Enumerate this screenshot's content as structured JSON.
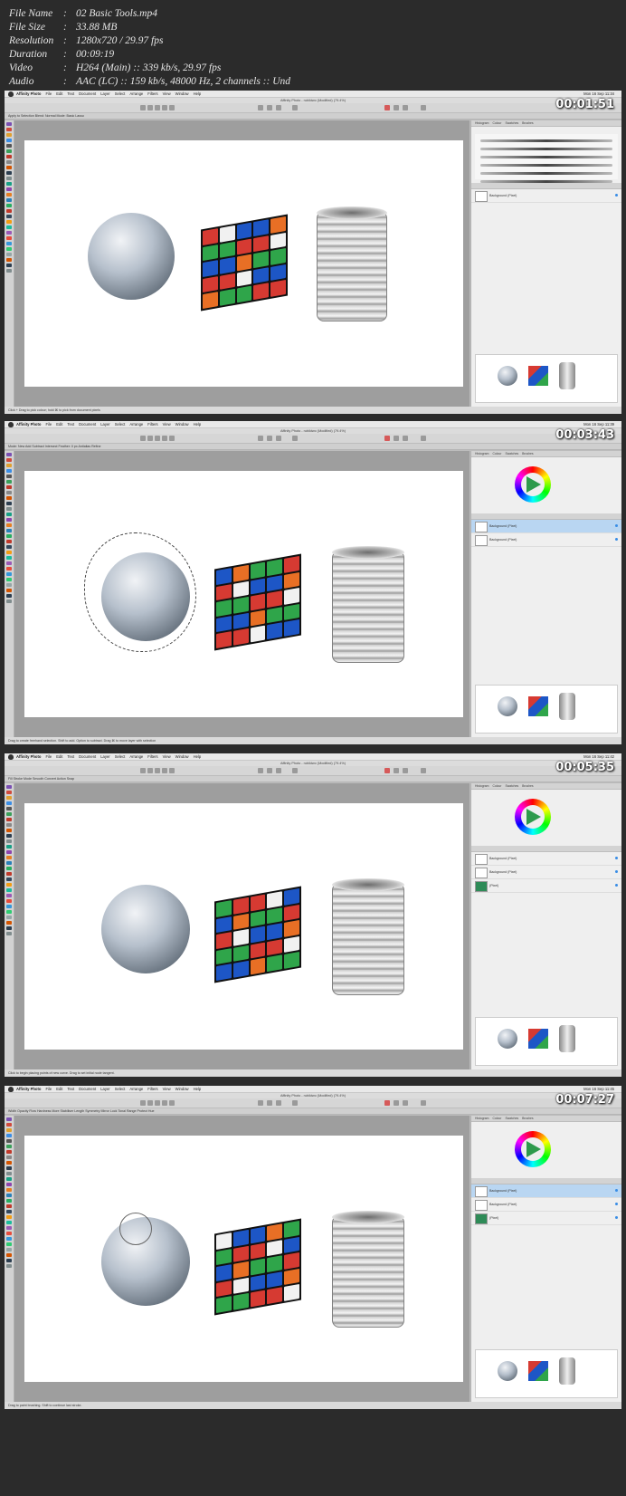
{
  "file_info": [
    {
      "key": "File Name",
      "value": "02 Basic Tools.mp4"
    },
    {
      "key": "File Size",
      "value": "33.88 MB"
    },
    {
      "key": "Resolution",
      "value": "1280x720 / 29.97 fps"
    },
    {
      "key": "Duration",
      "value": "00:09:19"
    },
    {
      "key": "Video",
      "value": "H264 (Main) :: 339 kb/s, 29.97 fps"
    },
    {
      "key": "Audio",
      "value": "AAC (LC) :: 159 kb/s, 48000 Hz, 2 channels :: Und"
    }
  ],
  "app": {
    "menus": [
      "Affinity Photo",
      "File",
      "Edit",
      "Text",
      "Document",
      "Layer",
      "Select",
      "Arrange",
      "Filters",
      "View",
      "Window",
      "Help"
    ],
    "window_title": "Affinity Photo - rubiktwo (Modified) (79.4%)"
  },
  "frames": [
    {
      "timestamp": "00:01:51",
      "clock": "Mon 16 Sep 11:34",
      "panel": "brushes",
      "panel_tabs": [
        "Histogram",
        "Colour",
        "Swatches",
        "Brushes"
      ],
      "context_text": "Apply to Selection   Blend: Normal   Mode: Basic Lasso",
      "status_text": "Click + Drag to pick colour; hold ⌘ to pick from document pixels",
      "layers": [
        {
          "name": "Background (Pixel)",
          "selected": false
        }
      ]
    },
    {
      "timestamp": "00:03:43",
      "clock": "Mon 16 Sep 11:39",
      "panel": "colour",
      "panel_tabs": [
        "Histogram",
        "Colour",
        "Swatches",
        "Brushes"
      ],
      "context_text": "Mode: New  Add  Subtract  Intersect   Feather: 0 px   Antialias   Refine",
      "status_text": "Drag to create freehand selection. Shift to add. Option to subtract. Drag ⌘ to move layer with selection",
      "layers": [
        {
          "name": "Background (Pixel)",
          "selected": true
        },
        {
          "name": "Background (Pixel)",
          "selected": false
        }
      ]
    },
    {
      "timestamp": "00:05:35",
      "clock": "Mon 16 Sep 11:42",
      "panel": "colour",
      "panel_tabs": [
        "Histogram",
        "Colour",
        "Swatches",
        "Brushes"
      ],
      "context_text": "Fill   Stroke   Mode   Smooth   Convert   Action   Snap",
      "status_text": "Click to begin placing points of new curve. Drag to set initial node tangent.",
      "layers": [
        {
          "name": "Background (Pixel)",
          "selected": false
        },
        {
          "name": "Background (Pixel)",
          "selected": false
        },
        {
          "name": "(Pixel)",
          "selected": false
        }
      ]
    },
    {
      "timestamp": "00:07:27",
      "clock": "Mon 16 Sep 11:45",
      "panel": "colour",
      "panel_tabs": [
        "Histogram",
        "Colour",
        "Swatches",
        "Brushes"
      ],
      "context_text": "Width  Opacity  Flow  Hardness  More   Stabiliser   Length  Symmetry   Mirror   Lock   Tonal Range  Protect Hue",
      "status_text": "Drag to paint brushing. Shift to continue last stroke.",
      "layers": [
        {
          "name": "Background (Pixel)",
          "selected": true
        },
        {
          "name": "Background (Pixel)",
          "selected": false
        },
        {
          "name": "(Pixel)",
          "selected": false
        }
      ]
    }
  ],
  "colors": {
    "accent": "#3a8ee6",
    "selection": "#b9d6f2",
    "canvas_bg": "#9e9e9e"
  }
}
